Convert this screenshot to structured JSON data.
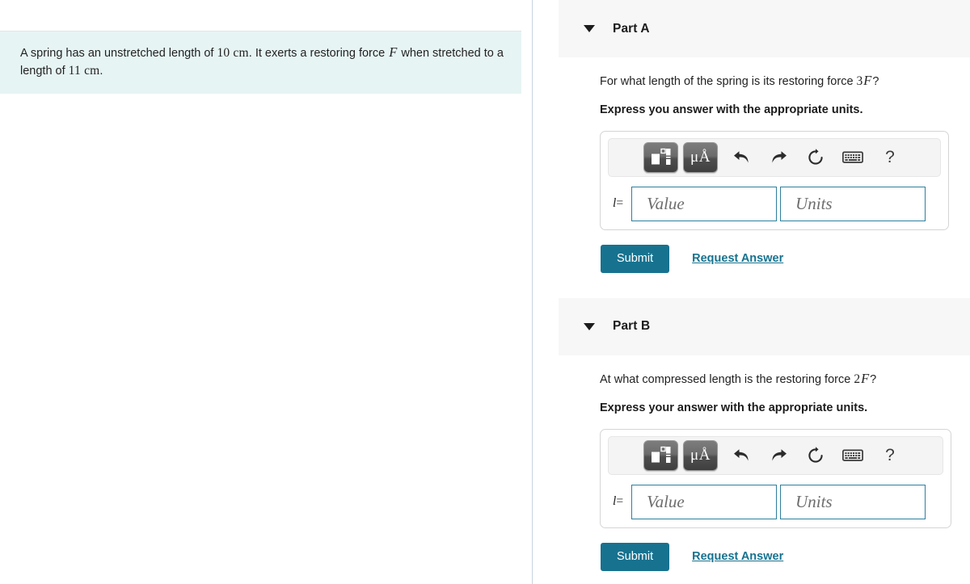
{
  "problem": {
    "text_before_var": "A spring has an unstretched length of ",
    "unstretched_length": "10 cm",
    "text_middle": ". It exerts a restoring force ",
    "force_symbol": "F",
    "text_after": " when stretched to a length of ",
    "stretched_length": "11 cm",
    "text_end": ".",
    "full_text": "A spring has an unstretched length of 10 cm. It exerts a restoring force F when stretched to a length of 11 cm.",
    "background_color": "#e7f4f4"
  },
  "parts": [
    {
      "id": "part-a",
      "title": "Part A",
      "caret_icon": "triangle-down-icon",
      "question_prefix": "For what length of the spring is its restoring force ",
      "question_coefficient": "3",
      "question_symbol": "F",
      "question_suffix": "?",
      "question_full": "For what length of the spring is its restoring force 3F?",
      "instruction": "Express you answer with the appropriate units.",
      "toolbar": {
        "template_button_label": "template-icon",
        "units_button_label": "μÅ",
        "undo_label": "undo-icon",
        "redo_label": "redo-icon",
        "reset_label": "reset-icon",
        "keyboard_label": "keyboard-icon",
        "help_label": "?"
      },
      "answer": {
        "label_variable": "l",
        "label_equals": "=",
        "value_placeholder": "Value",
        "units_placeholder": "Units",
        "value_text": "",
        "units_text": "",
        "field_border_color": "#2d7f9d"
      },
      "submit_label": "Submit",
      "request_answer_label": "Request Answer"
    },
    {
      "id": "part-b",
      "title": "Part B",
      "caret_icon": "triangle-down-icon",
      "question_prefix": "At what compressed length is the restoring force ",
      "question_coefficient": "2",
      "question_symbol": "F",
      "question_suffix": "?",
      "question_full": "At what compressed length is the restoring force 2F?",
      "instruction": "Express your answer with the appropriate units.",
      "toolbar": {
        "template_button_label": "template-icon",
        "units_button_label": "μÅ",
        "undo_label": "undo-icon",
        "redo_label": "redo-icon",
        "reset_label": "reset-icon",
        "keyboard_label": "keyboard-icon",
        "help_label": "?"
      },
      "answer": {
        "label_variable": "l",
        "label_equals": "=",
        "value_placeholder": "Value",
        "units_placeholder": "Units",
        "value_text": "",
        "units_text": "",
        "field_border_color": "#2d7f9d"
      },
      "submit_label": "Submit",
      "request_answer_label": "Request Answer"
    }
  ],
  "colors": {
    "accent": "#17728f",
    "header_panel": "#f7f7f7",
    "problem_bg": "#e7f4f4",
    "field_border": "#2d7f9d"
  }
}
